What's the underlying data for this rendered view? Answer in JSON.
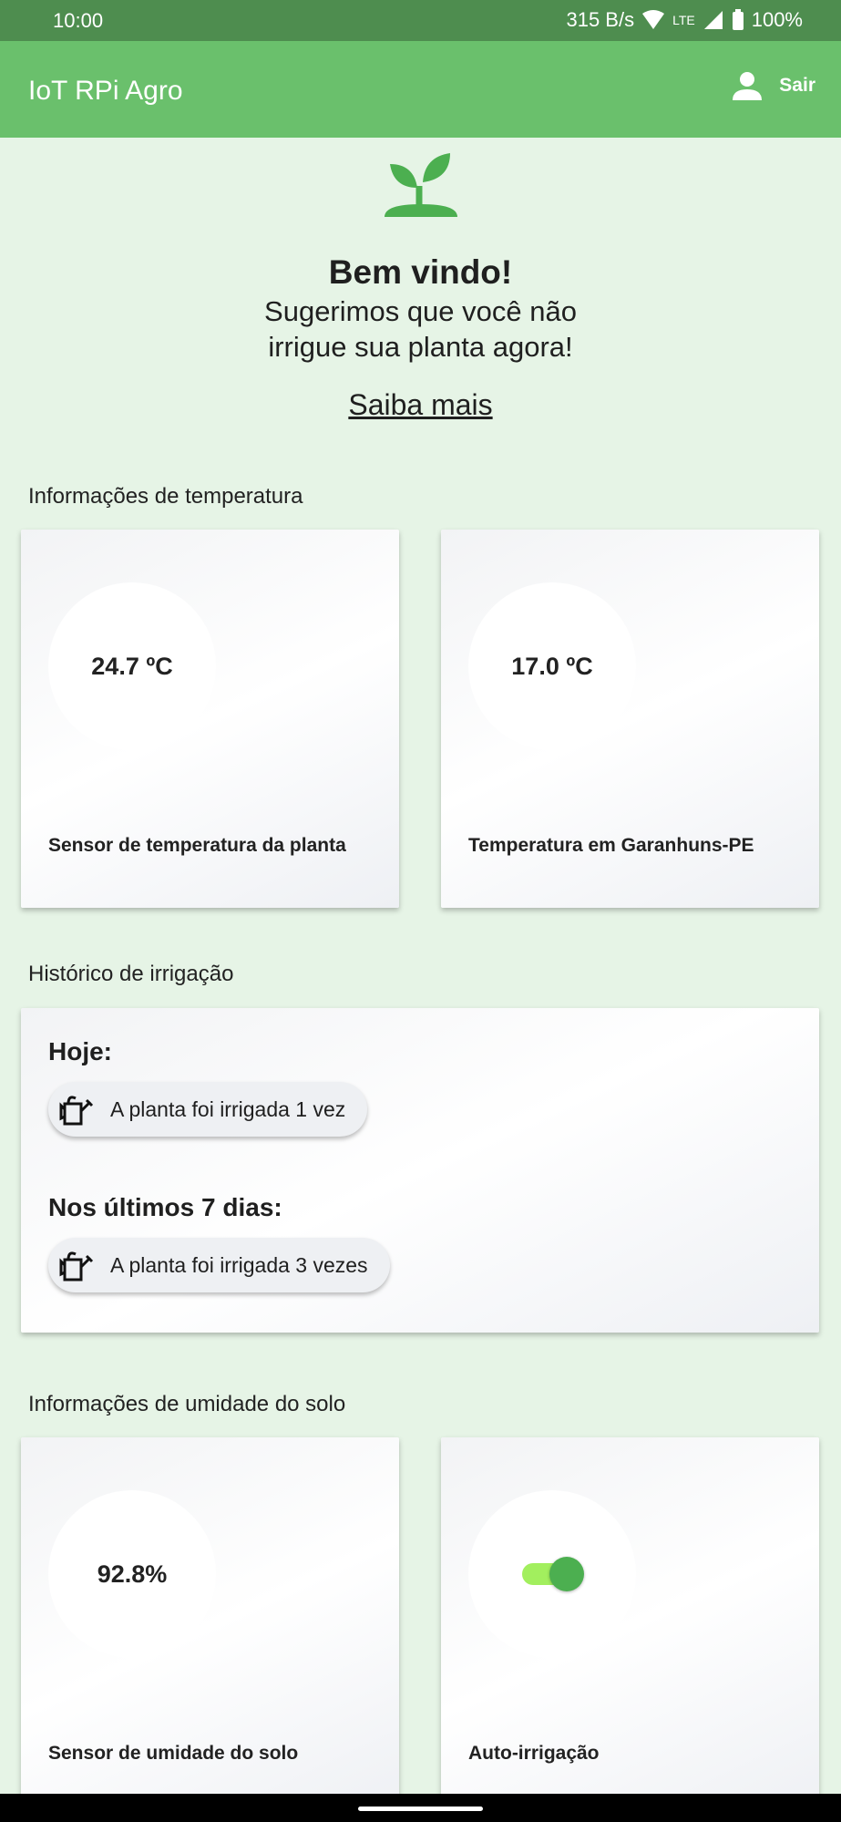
{
  "status": {
    "time": "10:00",
    "net_speed": "315 B/s",
    "network": "LTE",
    "battery": "100%"
  },
  "appbar": {
    "title": "IoT RPi Agro",
    "logout_label": "Sair"
  },
  "welcome": {
    "title": "Bem vindo!",
    "line1": "Sugerimos que você não",
    "line2": "irrigue sua planta agora!",
    "link": "Saiba mais"
  },
  "sections": {
    "temperature": "Informações de temperatura",
    "history": "Histórico de irrigação",
    "soil": "Informações de umidade do solo"
  },
  "temperature_cards": [
    {
      "value": "24.7 ºC",
      "label": "Sensor de temperatura da planta"
    },
    {
      "value": "17.0 ºC",
      "label": "Temperatura em Garanhuns-PE"
    }
  ],
  "history": {
    "today_title": "Hoje:",
    "today_text": "A planta foi irrigada 1 vez",
    "week_title": "Nos últimos 7 dias:",
    "week_text": "A planta foi irrigada 3 vezes"
  },
  "soil_cards": [
    {
      "value": "92.8%",
      "label": "Sensor de umidade do solo"
    },
    {
      "label": "Auto-irrigação",
      "toggle_on": true
    }
  ],
  "colors": {
    "appbar": "#6ac06c",
    "statusbar": "#4e8d4f",
    "background": "#e6f4e6",
    "accent": "#4caf50"
  }
}
